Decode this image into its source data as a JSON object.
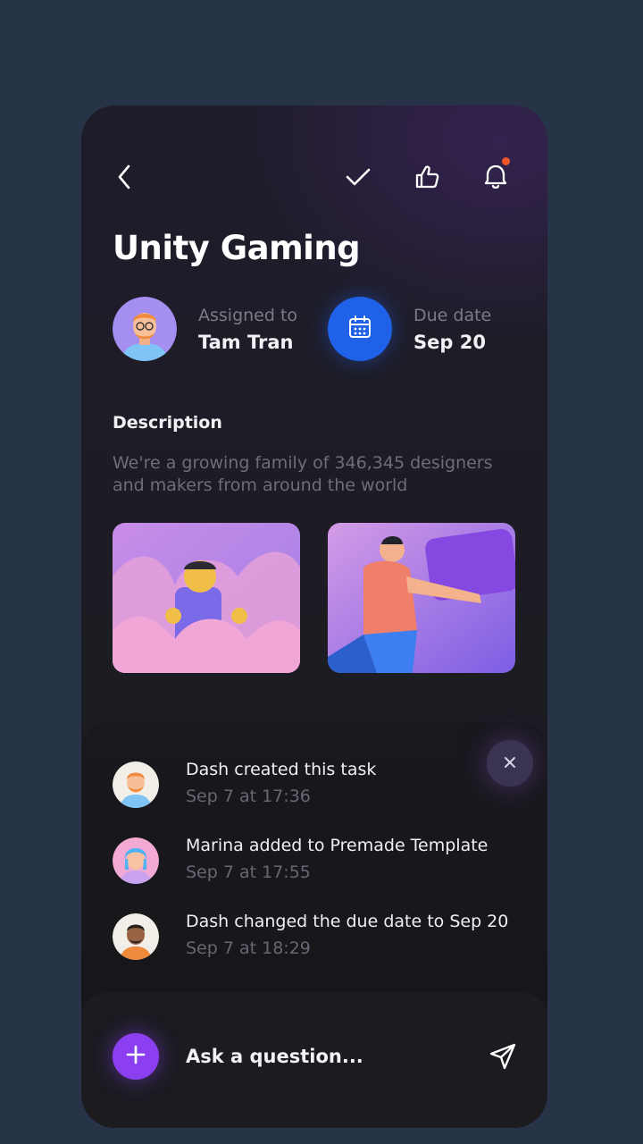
{
  "header": {
    "icons": [
      "back-chevron-icon",
      "check-icon",
      "thumbs-up-icon",
      "bell-icon"
    ],
    "notification_dot_color": "#f0562b"
  },
  "task": {
    "title": "Unity Gaming",
    "assigned_label": "Assigned to",
    "assigned_value": "Tam Tran",
    "due_label": "Due date",
    "due_value": "Sep 20",
    "description_title": "Description",
    "description": "We're a growing family of 346,345 designers and makers from around the world"
  },
  "activity": [
    {
      "text": "Dash created this task",
      "time": "Sep 7 at 17:36"
    },
    {
      "text": "Marina added to Premade Template",
      "time": "Sep 7 at 17:55"
    },
    {
      "text": "Dash changed the due date to Sep 20",
      "time": "Sep 7 at 18:29"
    }
  ],
  "composer": {
    "placeholder": "Ask a question..."
  },
  "colors": {
    "background": "#273346",
    "card": "#1d1c24",
    "accent_blue": "#1f62e8",
    "accent_purple": "#8b3ff0"
  }
}
